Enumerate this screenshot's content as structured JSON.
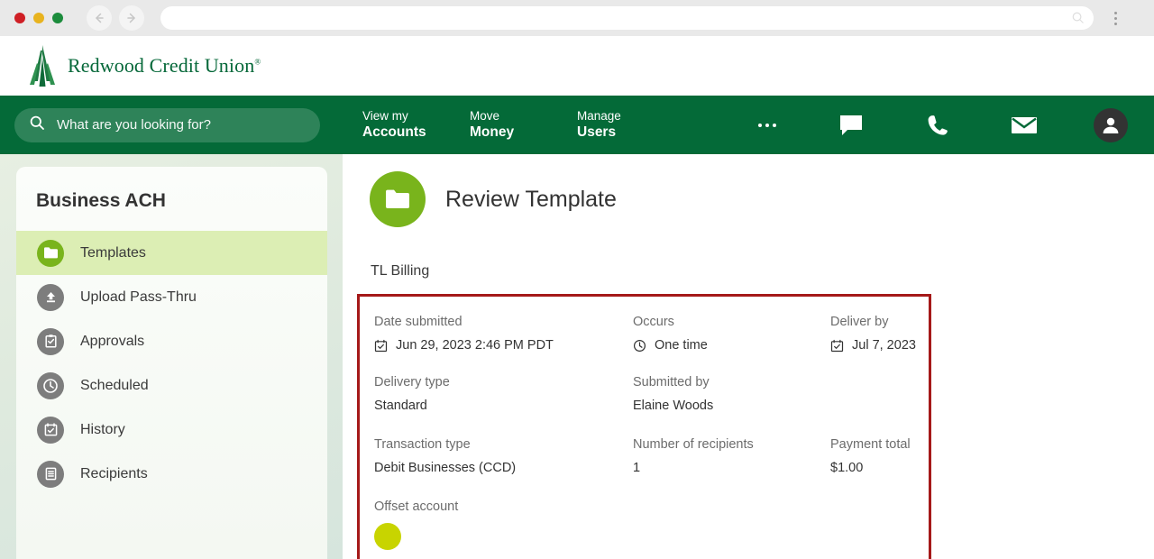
{
  "browser": {
    "url_value": "",
    "url_placeholder": "",
    "search_icon": "search-icon",
    "menu_icon": "kebab-menu-icon",
    "back_icon": "arrow-left-icon",
    "forward_icon": "arrow-right-icon",
    "traffic_lights": [
      "close",
      "minimize",
      "maximize"
    ]
  },
  "brand": {
    "name": "Redwood Credit Union",
    "trademark": "®",
    "logo_icon": "redwood-tree-logo",
    "color": "#056839"
  },
  "header": {
    "bar_color": "#046a38",
    "search": {
      "placeholder": "What are you looking for?",
      "value": "",
      "icon": "search-icon"
    },
    "nav": [
      {
        "small": "View my",
        "big": "Accounts"
      },
      {
        "small": "Move",
        "big": "Money"
      },
      {
        "small": "Manage",
        "big": "Users"
      }
    ],
    "icons": [
      {
        "name": "more-options-icon",
        "glyph": "ellipsis"
      },
      {
        "name": "chat-icon",
        "glyph": "chat-bubble"
      },
      {
        "name": "phone-icon",
        "glyph": "phone"
      },
      {
        "name": "mail-icon",
        "glyph": "envelope"
      },
      {
        "name": "user-avatar-icon",
        "glyph": "person"
      }
    ]
  },
  "sidebar": {
    "title": "Business ACH",
    "active_color": "#dceeb4",
    "items": [
      {
        "label": "Templates",
        "icon": "folder-icon",
        "active": true
      },
      {
        "label": "Upload Pass-Thru",
        "icon": "upload-icon",
        "active": false
      },
      {
        "label": "Approvals",
        "icon": "clipboard-check-icon",
        "active": false
      },
      {
        "label": "Scheduled",
        "icon": "clock-icon",
        "active": false
      },
      {
        "label": "History",
        "icon": "calendar-check-icon",
        "active": false
      },
      {
        "label": "Recipients",
        "icon": "list-icon",
        "active": false
      }
    ]
  },
  "main": {
    "page_icon": "folder-icon",
    "page_icon_color": "#79b41c",
    "title": "Review Template",
    "template_name": "TL Billing",
    "highlight_color": "#a51919",
    "details": [
      [
        {
          "label": "Date submitted",
          "value": "Jun 29, 2023 2:46 PM PDT",
          "icon": "calendar-check-icon"
        },
        {
          "label": "Occurs",
          "value": "One time",
          "icon": "clock-icon"
        },
        {
          "label": "Deliver by",
          "value": "Jul 7, 2023",
          "icon": "calendar-check-icon"
        }
      ],
      [
        {
          "label": "Delivery type",
          "value": "Standard",
          "icon": ""
        },
        {
          "label": "Submitted by",
          "value": "Elaine Woods",
          "icon": ""
        },
        {
          "label": "",
          "value": "",
          "icon": ""
        }
      ],
      [
        {
          "label": "Transaction type",
          "value": "Debit Businesses (CCD)",
          "icon": ""
        },
        {
          "label": "Number of recipients",
          "value": "1",
          "icon": ""
        },
        {
          "label": "Payment total",
          "value": "$1.00",
          "icon": ""
        }
      ]
    ],
    "offset_account_label": "Offset account",
    "offset_account_icon": "account-circle-icon"
  }
}
